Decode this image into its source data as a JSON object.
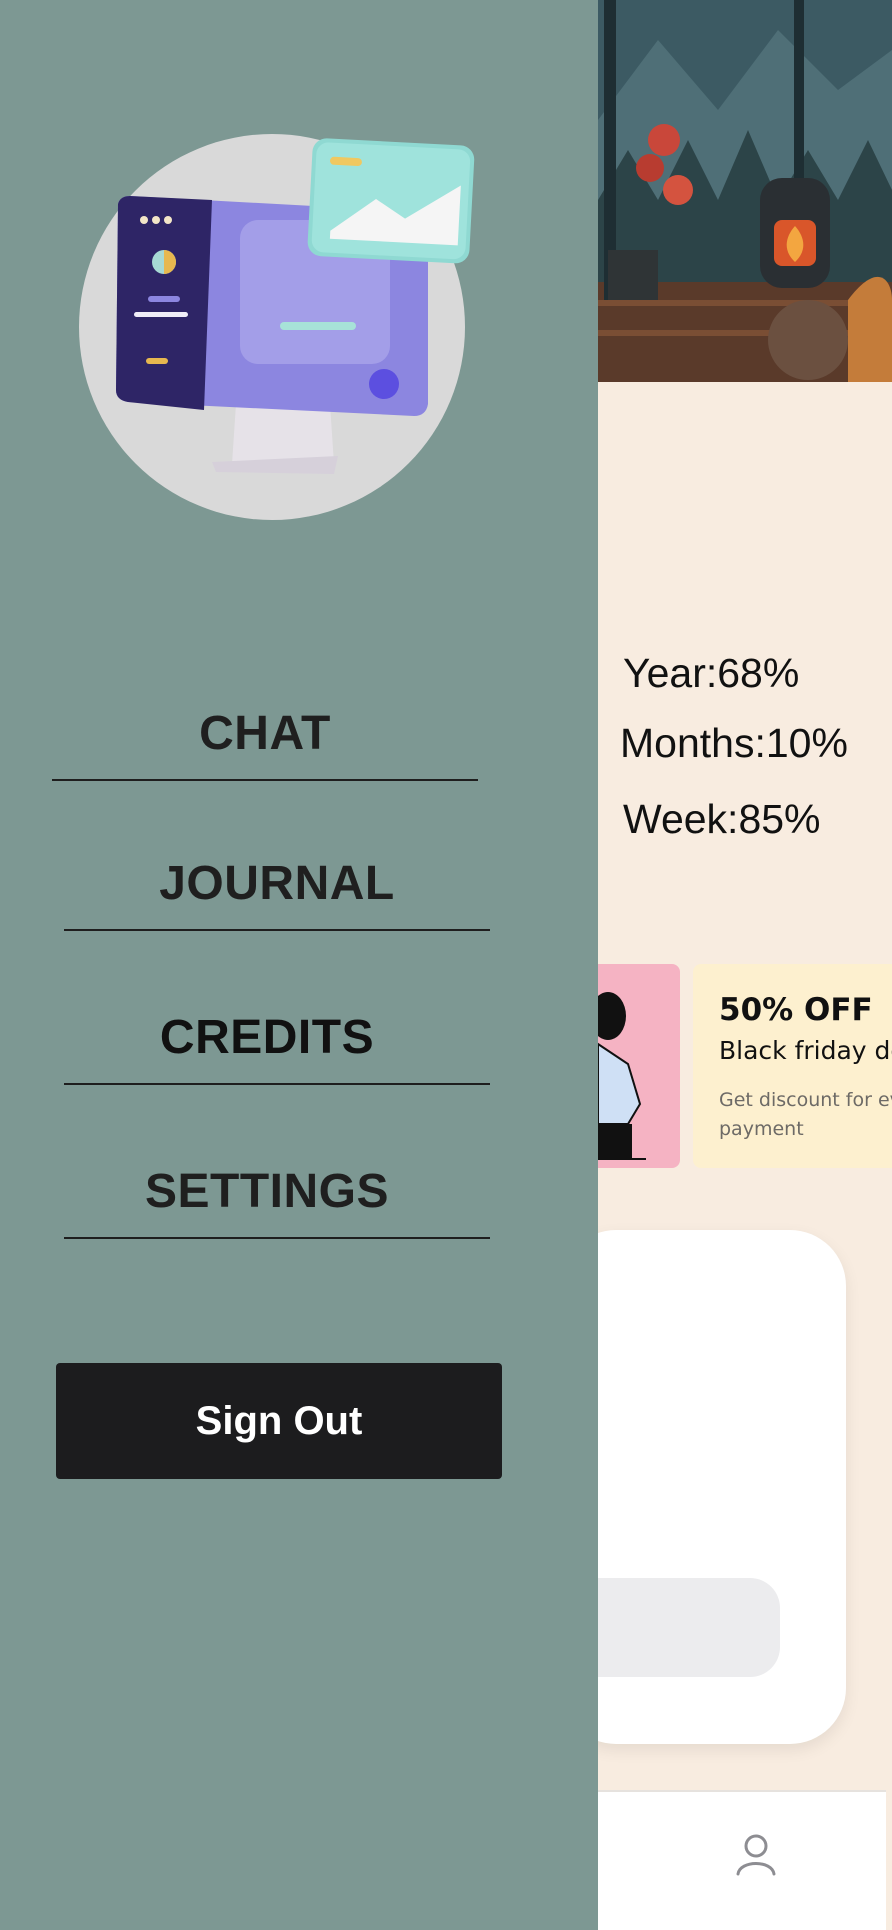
{
  "drawer": {
    "illustration": "computer-illustration",
    "menu": [
      {
        "id": "chat",
        "label": "CHAT"
      },
      {
        "id": "journal",
        "label": "JOURNAL"
      },
      {
        "id": "credits",
        "label": "CREDITS"
      },
      {
        "id": "settings",
        "label": "SETTINGS"
      }
    ],
    "sign_out_label": "Sign Out"
  },
  "background": {
    "hero_image": "cozy-cabin-fireplace-illustration",
    "stats": {
      "year": "Year:68%",
      "months": "Months:10%",
      "week": "Week:85%"
    },
    "promo": {
      "title": "50% OFF",
      "subtitle": "Black friday de",
      "description": "Get discount for eve up and payment"
    },
    "bottom_nav": {
      "profile_icon": "person-icon"
    }
  },
  "colors": {
    "drawer_bg": "#7d9893",
    "page_bg": "#f8ece0",
    "button_bg": "#1c1c1e",
    "promo_pink": "#f5b3c3",
    "promo_cream": "#fdf0cf"
  }
}
